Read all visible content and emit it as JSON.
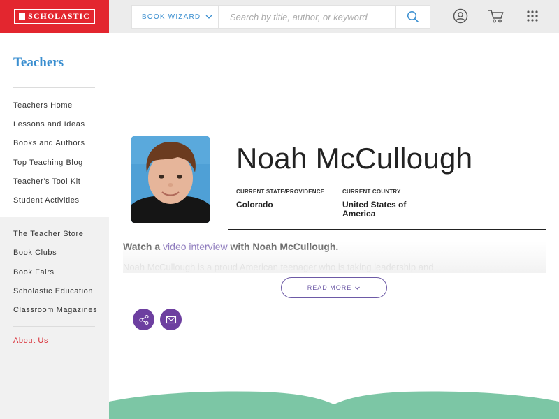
{
  "header": {
    "logo_text": "SCHOLASTIC",
    "book_wizard_label": "BOOK WIZARD",
    "search_placeholder": "Search by title, author, or keyword",
    "icons": [
      "search-icon",
      "account-icon",
      "cart-icon",
      "apps-grid-icon"
    ]
  },
  "sidebar": {
    "title": "Teachers",
    "group1": [
      {
        "label": "Teachers Home"
      },
      {
        "label": "Lessons and Ideas"
      },
      {
        "label": "Books and Authors"
      },
      {
        "label": "Top Teaching Blog"
      },
      {
        "label": "Teacher's Tool Kit"
      },
      {
        "label": "Student Activities"
      }
    ],
    "group2": [
      {
        "label": "The Teacher Store"
      },
      {
        "label": "Book Clubs"
      },
      {
        "label": "Book Fairs"
      },
      {
        "label": "Scholastic Education"
      },
      {
        "label": "Classroom Magazines"
      }
    ],
    "about": "About Us"
  },
  "profile": {
    "name": "Noah McCullough",
    "state_label": "CURRENT STATE/PROVIDENCE",
    "state_value": "Colorado",
    "country_label": "CURRENT COUNTRY",
    "country_value": "United States of America",
    "intro_prefix": "Watch a ",
    "intro_link": "video interview",
    "intro_suffix": " with Noah McCullough.",
    "faded_text": "Noah McCullough is a proud American teenager who is taking leadership and",
    "read_more": "READ MORE"
  },
  "colors": {
    "brand_red": "#e3262f",
    "accent_blue": "#3b8fd0",
    "accent_purple": "#6d3fa0",
    "footer_green": "#7cc6a5"
  }
}
